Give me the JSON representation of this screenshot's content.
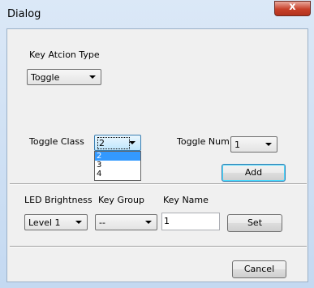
{
  "window": {
    "title": "Dialog",
    "close_glyph": "x"
  },
  "key_action": {
    "label": "Key Atcion Type",
    "value": "Toggle"
  },
  "toggle_class": {
    "label": "Toggle Class",
    "value": "2",
    "options": [
      "2",
      "3",
      "4"
    ],
    "selected_index": 0
  },
  "toggle_num": {
    "label": "Toggle Num",
    "value": "1"
  },
  "add_button": "Add",
  "led_brightness": {
    "label": "LED Brightness",
    "value": "Level 1"
  },
  "key_group": {
    "label": "Key Group",
    "value": "--"
  },
  "key_name": {
    "label": "Key Name",
    "value": "1"
  },
  "set_button": "Set",
  "cancel_button": "Cancel"
}
